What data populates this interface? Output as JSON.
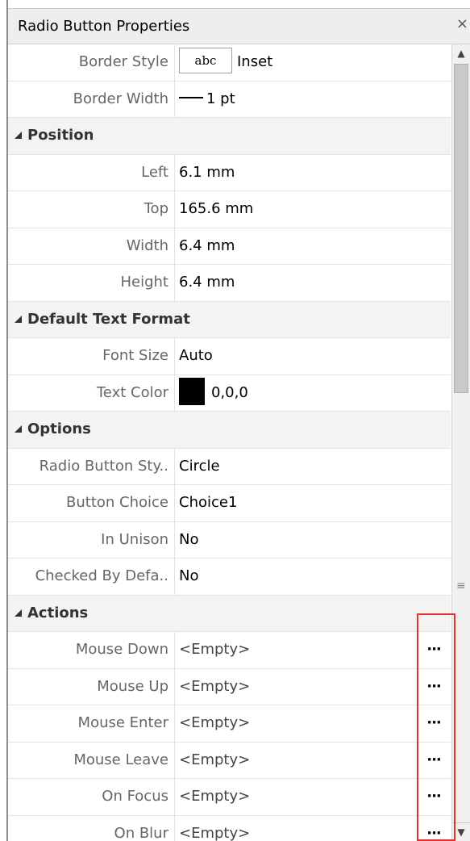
{
  "panel": {
    "title": "Radio Button Properties",
    "close_glyph": "×"
  },
  "rows": {
    "border_style": {
      "name": "Border Style",
      "swatch": "abc",
      "value": "Inset"
    },
    "border_width": {
      "name": "Border Width",
      "value": "1 pt"
    },
    "cat_position": "Position",
    "left": {
      "name": "Left",
      "value": "6.1 mm"
    },
    "top": {
      "name": "Top",
      "value": "165.6 mm"
    },
    "width": {
      "name": "Width",
      "value": "6.4 mm"
    },
    "height": {
      "name": "Height",
      "value": "6.4 mm"
    },
    "cat_text_format": "Default Text Format",
    "font_size": {
      "name": "Font Size",
      "value": "Auto"
    },
    "text_color": {
      "name": "Text Color",
      "value": "0,0,0",
      "swatch_color": "#000000"
    },
    "cat_options": "Options",
    "radio_style": {
      "name": "Radio Button Sty..",
      "value": "Circle"
    },
    "button_choice": {
      "name": "Button Choice",
      "value": "Choice1"
    },
    "in_unison": {
      "name": "In Unison",
      "value": "No"
    },
    "checked_default": {
      "name": "Checked By Defa..",
      "value": "No"
    },
    "cat_actions": "Actions",
    "mouse_down": {
      "name": "Mouse Down",
      "value": "<Empty>",
      "button": "···"
    },
    "mouse_up": {
      "name": "Mouse Up",
      "value": "<Empty>",
      "button": "···"
    },
    "mouse_enter": {
      "name": "Mouse Enter",
      "value": "<Empty>",
      "button": "···"
    },
    "mouse_leave": {
      "name": "Mouse Leave",
      "value": "<Empty>",
      "button": "···"
    },
    "on_focus": {
      "name": "On Focus",
      "value": "<Empty>",
      "button": "···"
    },
    "on_blur": {
      "name": "On Blur",
      "value": "<Empty>",
      "button": "···"
    }
  },
  "scrollbar": {
    "up_glyph": "▲",
    "down_glyph": "▼",
    "grip_glyph": "≡"
  },
  "colors": {
    "highlight": "#e53030",
    "category_bg": "#f3f3f3"
  }
}
